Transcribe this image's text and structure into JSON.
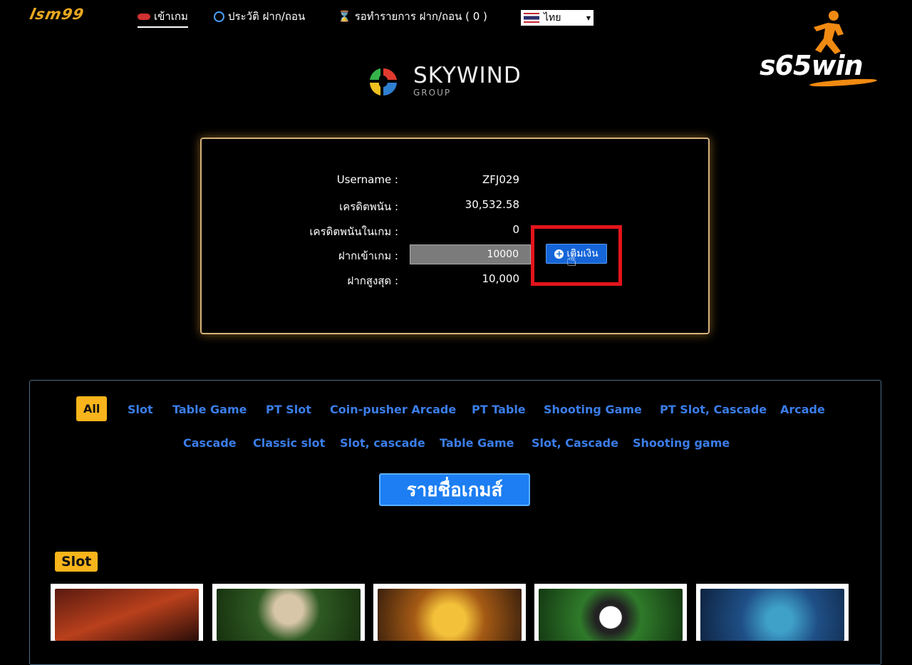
{
  "nav": {
    "logo": "lsm99",
    "items": [
      {
        "label": "เข้าเกม",
        "icon": "gamepad-icon"
      },
      {
        "label": "ประวัติ ฝาก/ถอน",
        "icon": "history-icon"
      },
      {
        "label": "รอทำรายการ ฝาก/ถอน ( 0 )",
        "icon": "hourglass-icon"
      }
    ],
    "language": "ไทย"
  },
  "watermark": {
    "text": "s65win"
  },
  "provider": {
    "name": "SKYWIND",
    "sub": "GROUP"
  },
  "account": {
    "username_label": "Username :",
    "username_value": "ZFJ029",
    "credit_label": "เครดิตพนัน :",
    "credit_value": "30,532.58",
    "ingame_label": "เครดิตพนันในเกม :",
    "ingame_value": "0",
    "deposit_label": "ฝากเข้าเกม :",
    "deposit_value": "10000",
    "topup_label": "เติมเงิน",
    "max_label": "ฝากสูงสุด :",
    "max_value": "10,000"
  },
  "filters": [
    "All",
    "Slot",
    "Table Game",
    "PT Slot",
    "Coin-pusher Arcade",
    "PT Table",
    "Shooting Game",
    "PT Slot, Cascade",
    "Arcade",
    "Cascade",
    "Classic slot",
    "Slot, cascade",
    "Table Game",
    "Slot, Cascade",
    "Shooting game"
  ],
  "games": {
    "title": "รายชื่อเกมส์",
    "category": "Slot"
  },
  "colors": {
    "accent": "#f7b41b",
    "primary": "#1c7ef2",
    "highlight": "#e4141b",
    "link": "#3b7de8"
  }
}
